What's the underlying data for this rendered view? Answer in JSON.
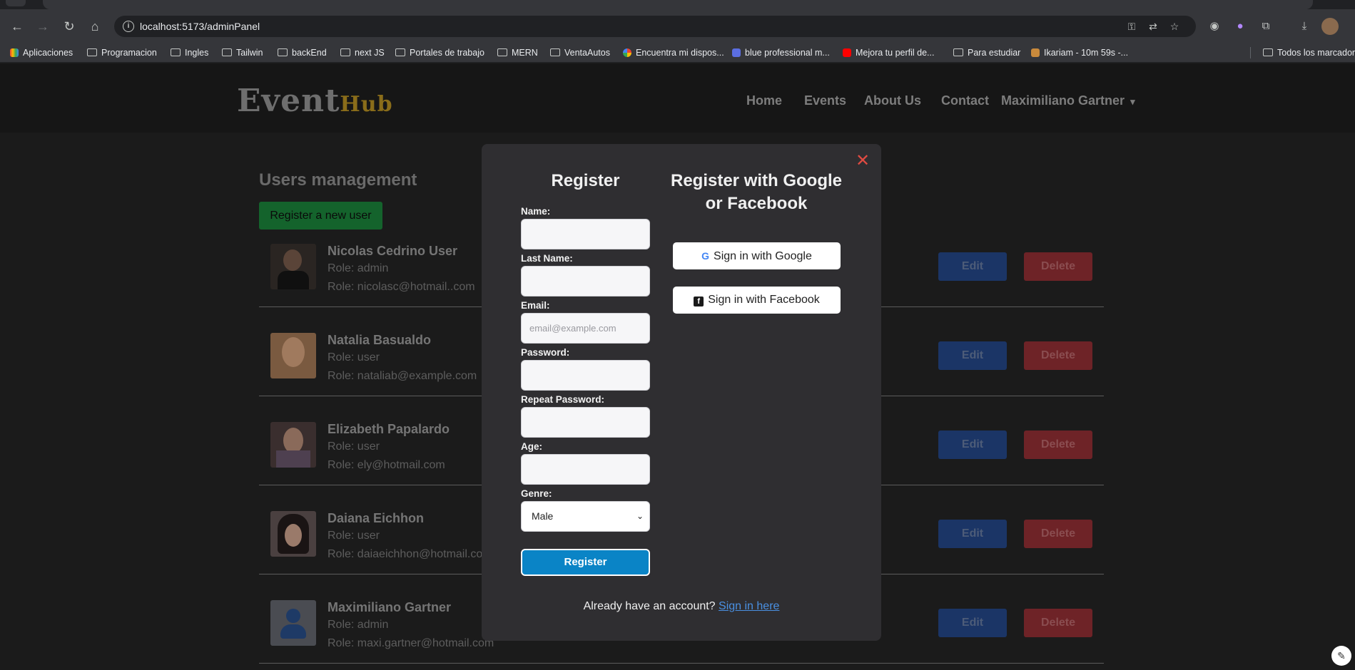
{
  "browser": {
    "url": "localhost:5173/adminPanel",
    "bookmarks": [
      {
        "label": "Aplicaciones",
        "icon": "apps-grid-icon"
      },
      {
        "label": "Programacion",
        "icon": "folder-icon"
      },
      {
        "label": "Ingles",
        "icon": "folder-icon"
      },
      {
        "label": "Tailwin",
        "icon": "folder-icon"
      },
      {
        "label": "backEnd",
        "icon": "folder-icon"
      },
      {
        "label": "next JS",
        "icon": "folder-icon"
      },
      {
        "label": "Portales de trabajo",
        "icon": "folder-icon"
      },
      {
        "label": "MERN",
        "icon": "folder-icon"
      },
      {
        "label": "VentaAutos",
        "icon": "folder-icon"
      },
      {
        "label": "Encuentra mi dispos...",
        "icon": "google-icon"
      },
      {
        "label": "blue professional m...",
        "icon": "site-icon"
      },
      {
        "label": "Mejora tu perfil de...",
        "icon": "youtube-icon"
      },
      {
        "label": "Para estudiar",
        "icon": "folder-icon"
      },
      {
        "label": "Ikariam - 10m 59s -...",
        "icon": "game-icon"
      },
      {
        "label": "Todos los marcadores",
        "icon": "folder-icon"
      }
    ]
  },
  "navbar": {
    "logo_event": "Event",
    "logo_hub": "Hub",
    "links": [
      "Home",
      "Events",
      "About Us",
      "Contact"
    ],
    "user": "Maximiliano Gartner"
  },
  "main": {
    "title": "Users management",
    "register_button": "Register a new user",
    "users": [
      {
        "name": "Nicolas Cedrino User",
        "role": "Role: admin",
        "email": "Role: nicolasc@hotmail..com"
      },
      {
        "name": "Natalia Basualdo",
        "role": "Role: user",
        "email": "Role: nataliab@example.com"
      },
      {
        "name": "Elizabeth Papalardo",
        "role": "Role: user",
        "email": "Role: ely@hotmail.com"
      },
      {
        "name": "Daiana Eichhon",
        "role": "Role: user",
        "email": "Role: daiaeichhon@hotmail.com"
      },
      {
        "name": "Maximiliano Gartner",
        "role": "Role: admin",
        "email": "Role: maxi.gartner@hotmail.com"
      }
    ],
    "edit_label": "Edit",
    "delete_label": "Delete"
  },
  "modal": {
    "title": "Register",
    "social_title": "Register with Google or Facebook",
    "fields": {
      "name": "Name:",
      "last_name": "Last Name:",
      "email": "Email:",
      "email_placeholder": "email@example.com",
      "password": "Password:",
      "repeat_password": "Repeat Password:",
      "age": "Age:",
      "genre": "Genre:",
      "genre_value": "Male"
    },
    "submit": "Register",
    "google": "Sign in with Google",
    "facebook": "Sign in with Facebook",
    "already": "Already have an account?",
    "signin_link": "Sign in here"
  },
  "colors": {
    "accent_blue": "#0a84c6",
    "edit": "#1b3566",
    "delete": "#6e2327",
    "register_green": "#14632c",
    "close": "#e04b42"
  }
}
